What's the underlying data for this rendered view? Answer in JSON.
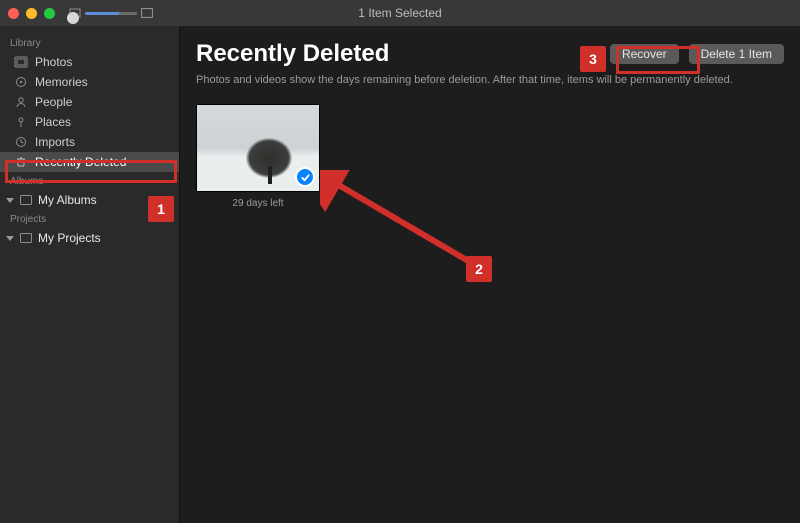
{
  "titlebar": {
    "title": "1 Item Selected"
  },
  "sidebar": {
    "sections": {
      "library": {
        "label": "Library",
        "items": [
          {
            "label": "Photos"
          },
          {
            "label": "Memories"
          },
          {
            "label": "People"
          },
          {
            "label": "Places"
          },
          {
            "label": "Imports"
          },
          {
            "label": "Recently Deleted"
          }
        ]
      },
      "albums": {
        "label": "Albums",
        "items": [
          {
            "label": "My Albums"
          }
        ]
      },
      "projects": {
        "label": "Projects",
        "items": [
          {
            "label": "My Projects"
          }
        ]
      }
    }
  },
  "content": {
    "title": "Recently Deleted",
    "subtitle": "Photos and videos show the days remaining before deletion. After that time, items will be permanently deleted.",
    "actions": {
      "recover": "Recover",
      "delete": "Delete 1 Item"
    },
    "items": [
      {
        "caption": "29 days left",
        "selected": true
      }
    ]
  },
  "annotations": {
    "step1": "1",
    "step2": "2",
    "step3": "3"
  }
}
